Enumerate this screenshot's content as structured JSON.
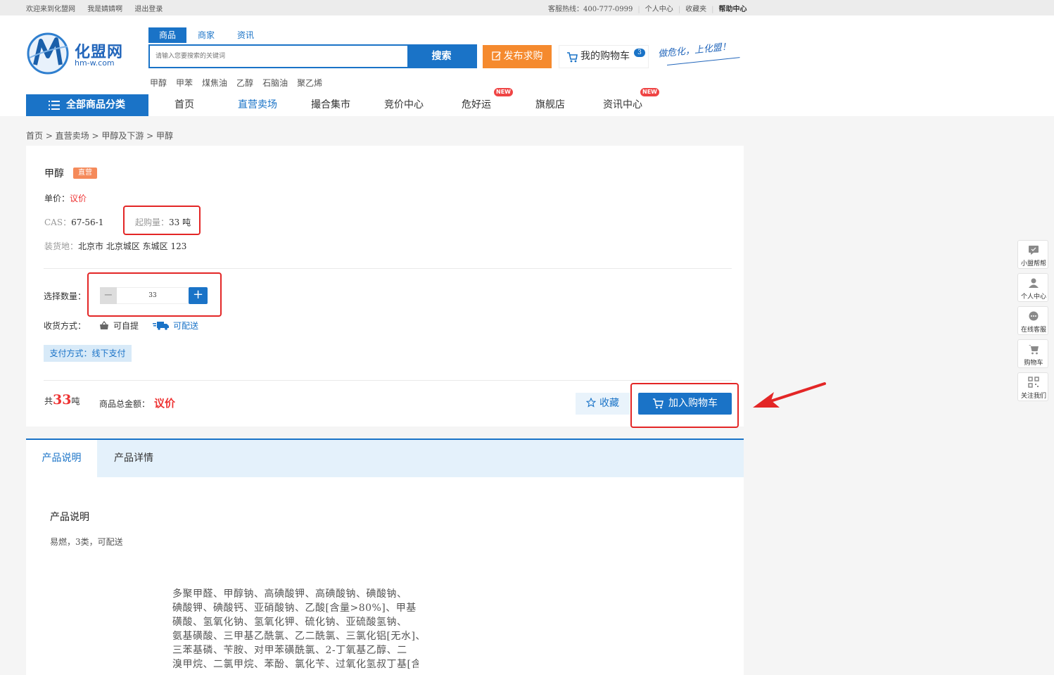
{
  "topbar": {
    "welcome": "欢迎来到化盟网",
    "username": "我是婧婧啊",
    "logout": "退出登录",
    "hotline": "客服热线：400-777-0999",
    "user_center": "个人中心",
    "favorites": "收藏夹",
    "help": "帮助中心"
  },
  "logo": {
    "name": "化盟网",
    "url": "hm-w.com"
  },
  "search": {
    "tabs": [
      "商品",
      "商家",
      "资讯"
    ],
    "placeholder": "请输入您要搜索的关键词",
    "button": "搜索",
    "hotwords": [
      "甲醇",
      "甲苯",
      "煤焦油",
      "乙醇",
      "石脑油",
      "聚乙烯"
    ]
  },
  "header": {
    "publish_label": "发布求购",
    "cart_label": "我的购物车",
    "cart_count": "3",
    "slogan": "做危化，上化盟！"
  },
  "nav": {
    "all_categories": "全部商品分类",
    "items": [
      "首页",
      "直营卖场",
      "撮合集市",
      "竞价中心",
      "危好运",
      "旗舰店",
      "资讯中心"
    ],
    "new_badge": "NEW"
  },
  "breadcrumb": "首页 > 直营卖场 > 甲醇及下游 > 甲醇",
  "product": {
    "name": "甲醇",
    "badge": "直营",
    "price_label": "单价：",
    "price_value": "议价",
    "cas_label": "CAS：",
    "cas_value": "67-56-1",
    "moq_label": "起购量：",
    "moq_value": "33 吨",
    "origin_label": "装货地：",
    "origin_value": "北京市 北京城区 东城区 123",
    "qty_label": "选择数量：",
    "qty_value": "33",
    "delivery_label": "收货方式：",
    "delivery_pickup": "可自提",
    "delivery_ship": "可配送",
    "payment": "支付方式：线下支付",
    "total_prefix": "共",
    "total_qty": "33",
    "total_unit": "吨",
    "amount_label": "商品总金额：",
    "amount_value": "议价",
    "fav_button": "收藏",
    "add_cart_button": "加入购物车"
  },
  "detail_tabs": [
    "产品说明",
    "产品详情"
  ],
  "description": {
    "title": "产品说明",
    "text": "易燃，3类，可配送",
    "scan_lines": [
      "多聚甲醛、甲醇钠、高碘酸钾、高碘酸钠、碘酸钠、",
      "碘酸钾、碘酸钙、亚硝酸钠、乙酸[含量>80%]、甲基",
      "磺酸、氢氧化钠、氢氧化钾、硫化钠、亚硫酸氢钠、",
      "氨基磺酸、三甲基乙酰氯、乙二酰氯、三氯化铝[无水]、",
      "三苯基磷、苄胺、对甲苯磺酰氯、2-丁氧基乙醇、二",
      "溴甲烷、二氯甲烷、苯酚、氯化苄、过氧化氢叔丁基[含"
    ]
  },
  "sidebar": [
    "小盟帮帮",
    "个人中心",
    "在线客服",
    "购物车",
    "关注我们"
  ],
  "colors": {
    "brand_blue": "#1a73c7",
    "orange": "#f58a2e",
    "price_red": "#e33333",
    "highlight_red": "#e32626"
  }
}
